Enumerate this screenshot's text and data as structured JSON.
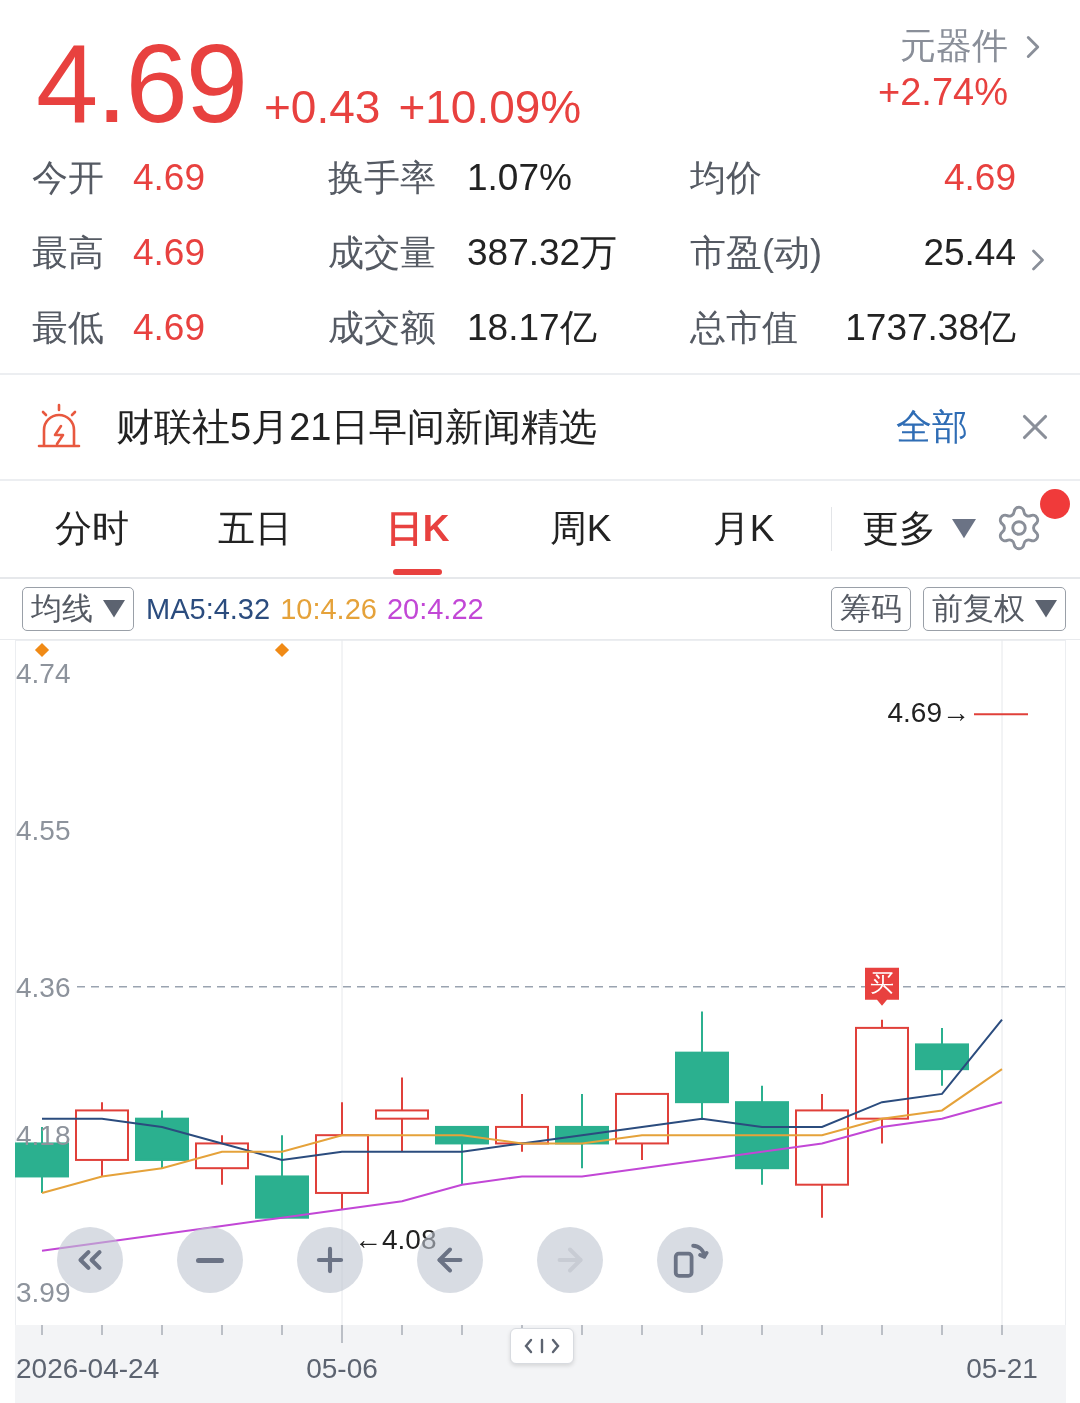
{
  "quote": {
    "price": "4.69",
    "change": "+0.43",
    "change_pct": "+10.09%",
    "sector": {
      "name": "元器件",
      "change": "+2.74%"
    }
  },
  "stats": [
    {
      "link": false,
      "items": [
        {
          "label": "今开",
          "value": "4.69",
          "rising": true
        },
        {
          "label": "换手率",
          "value": "1.07%",
          "rising": false
        },
        {
          "label": "均价",
          "value": "4.69",
          "rising": true
        }
      ]
    },
    {
      "link": true,
      "items": [
        {
          "label": "最高",
          "value": "4.69",
          "rising": true
        },
        {
          "label": "成交量",
          "value": "387.32万",
          "rising": false
        },
        {
          "label": "市盈(动)",
          "value": "25.44",
          "rising": false
        }
      ]
    },
    {
      "link": false,
      "items": [
        {
          "label": "最低",
          "value": "4.69",
          "rising": true
        },
        {
          "label": "成交额",
          "value": "18.17亿",
          "rising": false
        },
        {
          "label": "总市值",
          "value": "1737.38亿",
          "rising": false
        }
      ]
    }
  ],
  "news": {
    "headline": "财联社5月21日早间新闻精选",
    "action": "全部"
  },
  "tabs": [
    {
      "label": "分时",
      "selected": false
    },
    {
      "label": "五日",
      "selected": false
    },
    {
      "label": "日K",
      "selected": true
    },
    {
      "label": "周K",
      "selected": false
    },
    {
      "label": "月K",
      "selected": false
    }
  ],
  "more": {
    "label": "更多",
    "notification": true
  },
  "toolbar": {
    "ma_select": "均线",
    "legend": [
      {
        "label": "MA5:4.32",
        "color": "#2b4c7e"
      },
      {
        "label": "10:4.26",
        "color": "#e5a23a"
      },
      {
        "label": "20:4.22",
        "color": "#c247d6"
      }
    ],
    "chips_button": "筹码",
    "adjust_select": "前复权"
  },
  "chart": {
    "chart_data": {
      "type": "line",
      "categories": [
        null,
        null,
        null,
        null,
        null,
        "05-06",
        null,
        null,
        null,
        null,
        null,
        null,
        null,
        null,
        null,
        null,
        "05-21"
      ],
      "ylim": [
        3.95,
        4.78
      ],
      "yticks": [
        {
          "value": 4.74,
          "label": "4.74"
        },
        {
          "value": 4.55,
          "label": "4.55"
        },
        {
          "value": 4.36,
          "label": "4.36"
        },
        {
          "value": 4.18,
          "label": "4.18"
        },
        {
          "value": 3.99,
          "label": "3.99"
        }
      ],
      "series": [
        {
          "color": "#2b4c7e",
          "values": [
            4.2,
            4.2,
            4.19,
            4.17,
            4.15,
            4.16,
            4.16,
            4.16,
            4.17,
            4.18,
            4.19,
            4.2,
            4.19,
            4.19,
            4.22,
            4.23,
            4.32
          ]
        },
        {
          "color": "#e5a23a",
          "values": [
            4.11,
            4.13,
            4.14,
            4.16,
            4.16,
            4.18,
            4.18,
            4.18,
            4.17,
            4.17,
            4.18,
            4.18,
            4.18,
            4.18,
            4.2,
            4.21,
            4.26
          ]
        },
        {
          "color": "#c247d6",
          "values": [
            4.04,
            4.05,
            4.06,
            4.07,
            4.08,
            4.09,
            4.1,
            4.12,
            4.13,
            4.13,
            4.14,
            4.15,
            4.16,
            4.17,
            4.19,
            4.2,
            4.22
          ]
        }
      ],
      "ref_lines": [
        {
          "axis": "y",
          "value": 4.36
        }
      ],
      "annotations": [
        {
          "text": "4.69→"
        },
        {
          "text": "←4.08"
        },
        {
          "text": "买"
        },
        {
          "text": "2026-04-24"
        }
      ]
    },
    "controls": [
      {
        "kind": "first",
        "disabled": false
      },
      {
        "kind": "zoom-out",
        "disabled": false
      },
      {
        "kind": "zoom-in",
        "disabled": false
      },
      {
        "kind": "back",
        "disabled": false
      },
      {
        "kind": "forward",
        "disabled": true
      },
      {
        "kind": "rotate",
        "disabled": false
      }
    ]
  }
}
